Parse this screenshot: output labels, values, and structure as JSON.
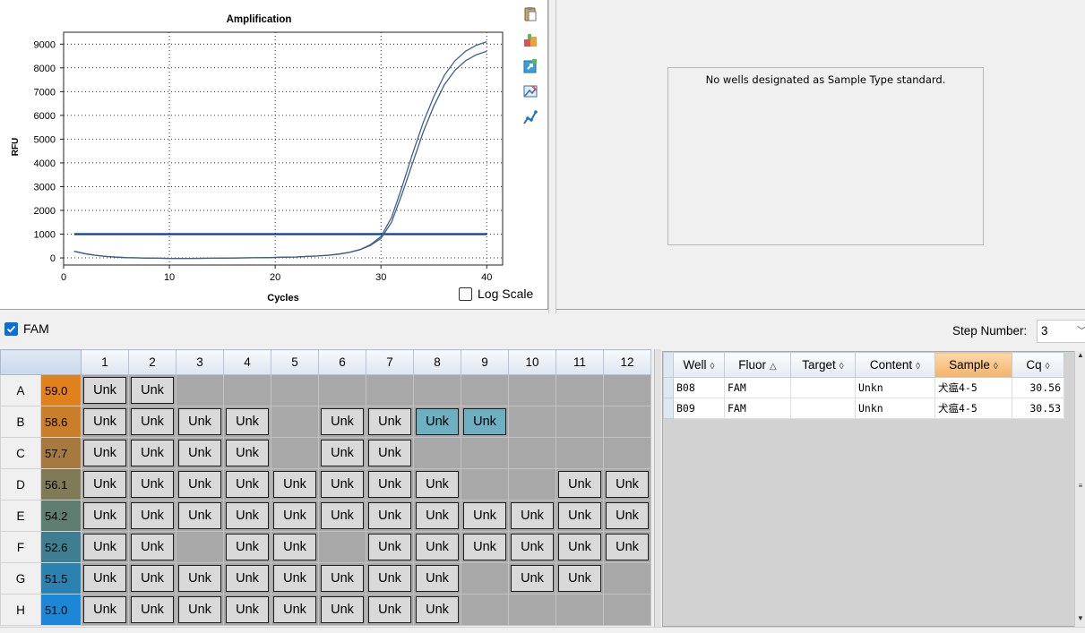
{
  "chart_data": {
    "type": "line",
    "title": "Amplification",
    "xlabel": "Cycles",
    "ylabel": "RFU",
    "xlim": [
      0,
      41.5
    ],
    "ylim": [
      -300,
      9500
    ],
    "x_ticks": [
      0,
      10,
      20,
      30,
      40
    ],
    "y_ticks": [
      0,
      1000,
      2000,
      3000,
      4000,
      5000,
      6000,
      7000,
      8000,
      9000
    ],
    "grid": "dotted",
    "threshold": 1000,
    "series": [
      {
        "x": [
          1,
          2,
          3,
          4,
          5,
          6,
          7,
          8,
          9,
          10,
          11,
          12,
          13,
          14,
          15,
          16,
          17,
          18,
          19,
          20,
          21,
          22,
          23,
          24,
          25,
          26,
          27,
          28,
          29,
          30,
          31,
          32,
          33,
          34,
          35,
          36,
          37,
          38,
          39,
          40
        ],
        "values": [
          280,
          180,
          110,
          60,
          30,
          10,
          0,
          -10,
          -15,
          -20,
          -20,
          -20,
          -18,
          -15,
          -10,
          -5,
          0,
          5,
          10,
          20,
          30,
          40,
          60,
          80,
          110,
          160,
          230,
          350,
          550,
          900,
          1700,
          3000,
          4400,
          5700,
          6800,
          7700,
          8300,
          8700,
          8950,
          9100
        ]
      },
      {
        "x": [
          1,
          2,
          3,
          4,
          5,
          6,
          7,
          8,
          9,
          10,
          11,
          12,
          13,
          14,
          15,
          16,
          17,
          18,
          19,
          20,
          21,
          22,
          23,
          24,
          25,
          26,
          27,
          28,
          29,
          30,
          31,
          32,
          33,
          34,
          35,
          36,
          37,
          38,
          39,
          40
        ],
        "values": [
          280,
          180,
          110,
          60,
          30,
          10,
          0,
          -10,
          -15,
          -20,
          -20,
          -20,
          -18,
          -15,
          -10,
          -5,
          0,
          5,
          10,
          20,
          30,
          40,
          60,
          80,
          110,
          160,
          230,
          340,
          520,
          820,
          1500,
          2700,
          4000,
          5300,
          6400,
          7300,
          7900,
          8300,
          8550,
          8700
        ]
      }
    ],
    "colors": {
      "curve": "#3d5f8a",
      "threshold": "#0b3d8c"
    }
  },
  "toolbar_icons": [
    "clipboard-icon",
    "export-icon",
    "refresh-export-icon",
    "image-icon",
    "graph-icon"
  ],
  "log_scale": {
    "label": "Log Scale",
    "checked": false
  },
  "standard_curve": {
    "message": "No wells designated as Sample Type standard."
  },
  "fluor_filter": {
    "label": "FAM",
    "checked": true
  },
  "step": {
    "label": "Step Number:",
    "value": "3"
  },
  "plate": {
    "columns": [
      "1",
      "2",
      "3",
      "4",
      "5",
      "6",
      "7",
      "8",
      "9",
      "10",
      "11",
      "12"
    ],
    "rows": [
      {
        "label": "A",
        "temp": "59.0",
        "temp_color": "#e0811c",
        "wells": [
          1,
          1,
          0,
          0,
          0,
          0,
          0,
          0,
          0,
          0,
          0,
          0
        ]
      },
      {
        "label": "B",
        "temp": "58.6",
        "temp_color": "#c97e2a",
        "wells": [
          1,
          1,
          1,
          1,
          0,
          1,
          1,
          2,
          2,
          0,
          0,
          0
        ]
      },
      {
        "label": "C",
        "temp": "57.7",
        "temp_color": "#a67a3e",
        "wells": [
          1,
          1,
          1,
          1,
          0,
          1,
          1,
          0,
          0,
          0,
          0,
          0
        ]
      },
      {
        "label": "D",
        "temp": "56.1",
        "temp_color": "#807a57",
        "wells": [
          1,
          1,
          1,
          1,
          1,
          1,
          1,
          1,
          0,
          0,
          1,
          1
        ]
      },
      {
        "label": "E",
        "temp": "54.2",
        "temp_color": "#5f7d71",
        "wells": [
          1,
          1,
          1,
          1,
          1,
          1,
          1,
          1,
          1,
          1,
          1,
          1
        ]
      },
      {
        "label": "F",
        "temp": "52.6",
        "temp_color": "#3f7d91",
        "wells": [
          1,
          1,
          0,
          1,
          1,
          0,
          1,
          1,
          1,
          1,
          1,
          1
        ]
      },
      {
        "label": "G",
        "temp": "51.5",
        "temp_color": "#2b82b0",
        "wells": [
          1,
          1,
          1,
          1,
          1,
          1,
          1,
          1,
          0,
          1,
          1,
          0
        ]
      },
      {
        "label": "H",
        "temp": "51.0",
        "temp_color": "#1b87d6",
        "wells": [
          1,
          1,
          1,
          1,
          1,
          1,
          1,
          1,
          0,
          0,
          0,
          0
        ]
      }
    ],
    "well_label": "Unk"
  },
  "results": {
    "columns": [
      {
        "label": "Well",
        "glyph": "◊"
      },
      {
        "label": "Fluor",
        "glyph": "△"
      },
      {
        "label": "Target",
        "glyph": "◊"
      },
      {
        "label": "Content",
        "glyph": "◊"
      },
      {
        "label": "Sample",
        "glyph": "◊"
      },
      {
        "label": "Cq",
        "glyph": "◊"
      }
    ],
    "rows": [
      [
        "B08",
        "FAM",
        "",
        "Unkn",
        "犬瘟4-5",
        "30.56"
      ],
      [
        "B09",
        "FAM",
        "",
        "Unkn",
        "犬瘟4-5",
        "30.53"
      ]
    ]
  }
}
